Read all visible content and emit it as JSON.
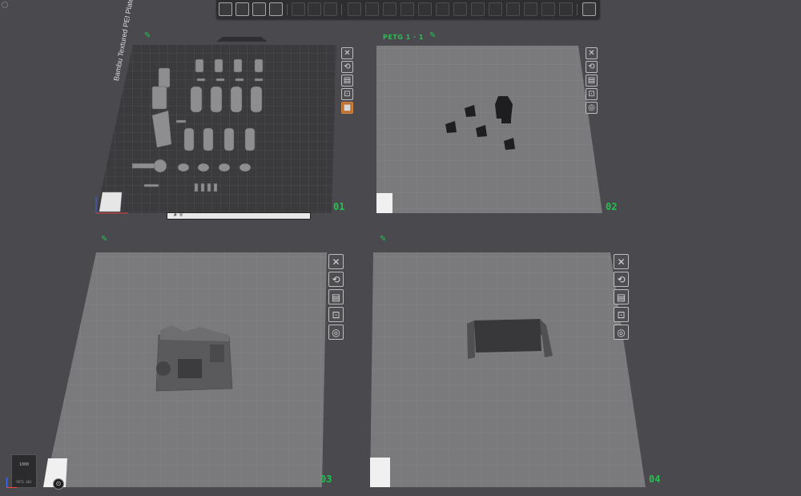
{
  "toolbar": {
    "left_icons": [
      "add-object-icon",
      "arrange-grid-icon",
      "orient-icon",
      "layout-plate-icon"
    ],
    "middle_icons": [
      "move-icon",
      "rotate-icon",
      "scale-icon",
      "layers-icon",
      "cut-icon",
      "support-paint-icon",
      "seam-icon",
      "text-icon",
      "measure-icon",
      "assembly-icon",
      "split-icon",
      "variable-layer-icon",
      "boolean-icon",
      "view-icon"
    ],
    "right_icon": "collapse-icon"
  },
  "plates": [
    {
      "number": "01",
      "name": "",
      "title_on_surface": "Bambu Textured PEI Plate",
      "footer_text": "# 0",
      "buttons": [
        "close-icon",
        "auto-orient-icon",
        "arrange-icon",
        "lock-icon",
        "filament-color-icon"
      ],
      "accent": "#c07030"
    },
    {
      "number": "02",
      "name": "PETG 1 · 1",
      "buttons": [
        "close-icon",
        "auto-orient-icon",
        "arrange-icon",
        "lock-icon",
        "settings-icon"
      ]
    },
    {
      "number": "03",
      "name": "",
      "buttons": [
        "close-icon",
        "auto-orient-icon",
        "arrange-icon",
        "lock-icon",
        "settings-icon"
      ]
    },
    {
      "number": "04",
      "name": "",
      "buttons": [
        "close-icon",
        "auto-orient-icon",
        "arrange-icon",
        "lock-icon",
        "settings-icon"
      ]
    }
  ],
  "minimap": {
    "top_text": "1000",
    "bottom_text": "PETG 001"
  },
  "colors": {
    "background": "#4a4a4e",
    "plate_surface": "#7a7a7c",
    "plate_dark": "#3b3b3e",
    "label_green": "#23c14e",
    "toolbar": "#2e2e30"
  }
}
